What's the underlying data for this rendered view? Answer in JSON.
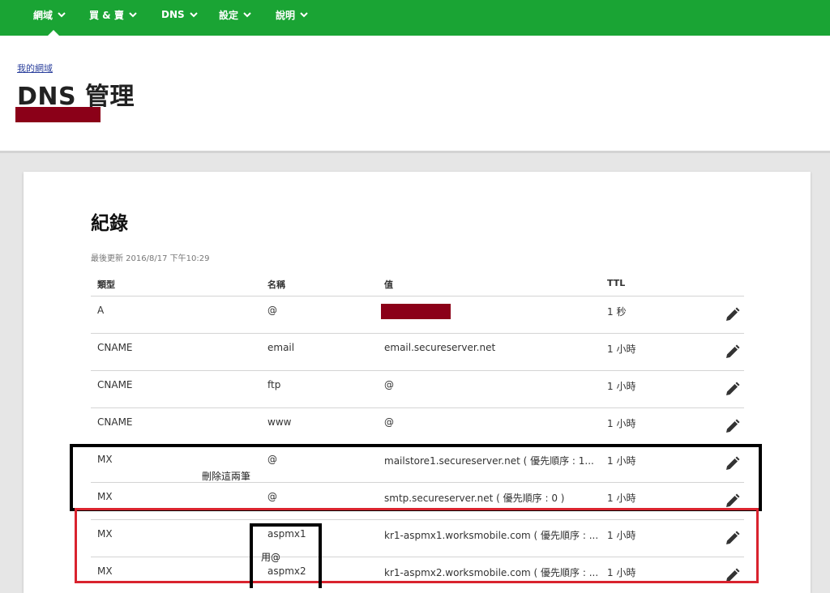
{
  "topnav": {
    "items": [
      {
        "label": "網域"
      },
      {
        "label": "買 & 賣"
      },
      {
        "label": "DNS"
      },
      {
        "label": "設定"
      },
      {
        "label": "說明"
      }
    ],
    "color": "#1aa434"
  },
  "header": {
    "breadcrumb": "我的網域",
    "title": "DNS 管理"
  },
  "records": {
    "title": "紀錄",
    "last_updated": "最後更新 2016/8/17 下午10:29",
    "columns": [
      "類型",
      "名稱",
      "值",
      "TTL"
    ],
    "rows": [
      {
        "type": "A",
        "name": "@",
        "value": "",
        "ttl": "1 秒"
      },
      {
        "type": "CNAME",
        "name": "email",
        "value": "email.secureserver.net",
        "ttl": "1 小時"
      },
      {
        "type": "CNAME",
        "name": "ftp",
        "value": "@",
        "ttl": "1 小時"
      },
      {
        "type": "CNAME",
        "name": "www",
        "value": "@",
        "ttl": "1 小時"
      },
      {
        "type": "MX",
        "name": "@",
        "value": "mailstore1.secureserver.net ( 優先順序 : 1...",
        "ttl": "1 小時"
      },
      {
        "type": "MX",
        "name": "@",
        "value": "smtp.secureserver.net ( 優先順序 : 0 )",
        "ttl": "1 小時"
      },
      {
        "type": "MX",
        "name": "aspmx1",
        "value": "kr1-aspmx1.worksmobile.com ( 優先順序 : ...",
        "ttl": "1 小時"
      },
      {
        "type": "MX",
        "name": "aspmx2",
        "value": "kr1-aspmx2.worksmobile.com ( 優先順序 : ...",
        "ttl": "1 小時"
      }
    ]
  },
  "annotations": {
    "delete_note": "刪除這兩筆",
    "use_at_note": "用@",
    "redaction_color": "#8b0018",
    "black_box_color": "#000000",
    "red_box_color": "#d9232e"
  }
}
